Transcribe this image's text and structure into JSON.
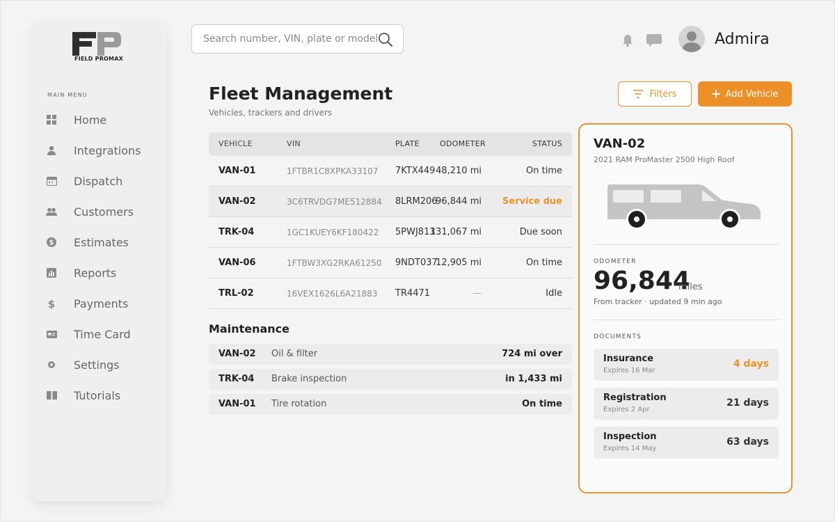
{
  "brand": {
    "logo_text": "FIELD PROMAX",
    "accent": "#ec8f26"
  },
  "sidebar": {
    "heading": "MAIN MENU",
    "items": [
      {
        "label": "Home",
        "icon": "grid-icon"
      },
      {
        "label": "Integrations",
        "icon": "user-icon"
      },
      {
        "label": "Dispatch",
        "icon": "calendar-icon"
      },
      {
        "label": "Customers",
        "icon": "users-icon"
      },
      {
        "label": "Estimates",
        "icon": "dollar-circle-icon"
      },
      {
        "label": "Reports",
        "icon": "bar-chart-icon"
      },
      {
        "label": "Payments",
        "icon": "dollar-icon"
      },
      {
        "label": "Time Card",
        "icon": "id-card-icon"
      },
      {
        "label": "Settings",
        "icon": "gear-icon"
      },
      {
        "label": "Tutorials",
        "icon": "book-icon"
      }
    ]
  },
  "search": {
    "placeholder": "Search number, VIN, plate or model"
  },
  "user": {
    "name": "Admira"
  },
  "header": {
    "title": "Fleet Management",
    "subtitle": "Vehicles, trackers and drivers",
    "filters_label": "Filters",
    "add_label": "Add Vehicle"
  },
  "vehicles": {
    "columns": [
      "VEHICLE",
      "VIN",
      "PLATE",
      "ODOMETER",
      "STATUS"
    ],
    "rows": [
      {
        "vehicle": "VAN-01",
        "vin": "1FTBR1C8XPKA33107",
        "plate": "7KTX449",
        "odometer": "48,210 mi",
        "status": "On time"
      },
      {
        "vehicle": "VAN-02",
        "vin": "3C6TRVDG7ME512884",
        "plate": "8LRM206",
        "odometer": "96,844 mi",
        "status": "Service due"
      },
      {
        "vehicle": "TRK-04",
        "vin": "1GC1KUEY6KF180422",
        "plate": "5PWJ813",
        "odometer": "131,067 mi",
        "status": "Due soon"
      },
      {
        "vehicle": "VAN-06",
        "vin": "1FTBW3XG2RKA61250",
        "plate": "9NDT037",
        "odometer": "12,905 mi",
        "status": "On time"
      },
      {
        "vehicle": "TRL-02",
        "vin": "16VEX1626L6A21883",
        "plate": "TR4471",
        "odometer": "—",
        "status": "Idle"
      }
    ]
  },
  "maintenance": {
    "title": "Maintenance",
    "rows": [
      {
        "vehicle": "VAN-02",
        "task": "Oil & filter",
        "status": "724 mi over"
      },
      {
        "vehicle": "TRK-04",
        "task": "Brake inspection",
        "status": "in 1,433 mi"
      },
      {
        "vehicle": "VAN-01",
        "task": "Tire rotation",
        "status": "On time"
      }
    ]
  },
  "detail": {
    "title": "VAN-02",
    "subtitle": "2021 RAM ProMaster 2500 High Roof",
    "odometer_label": "ODOMETER",
    "odometer_value": "96,844",
    "odometer_unit": "miles",
    "odometer_note": "From tracker · updated 9 min ago",
    "documents_label": "DOCUMENTS",
    "documents": [
      {
        "name": "Insurance",
        "expires": "Expires 16 Mar",
        "days": "4 days"
      },
      {
        "name": "Registration",
        "expires": "Expires 2 Apr",
        "days": "21 days"
      },
      {
        "name": "Inspection",
        "expires": "Expires 14 May",
        "days": "63 days"
      }
    ]
  }
}
